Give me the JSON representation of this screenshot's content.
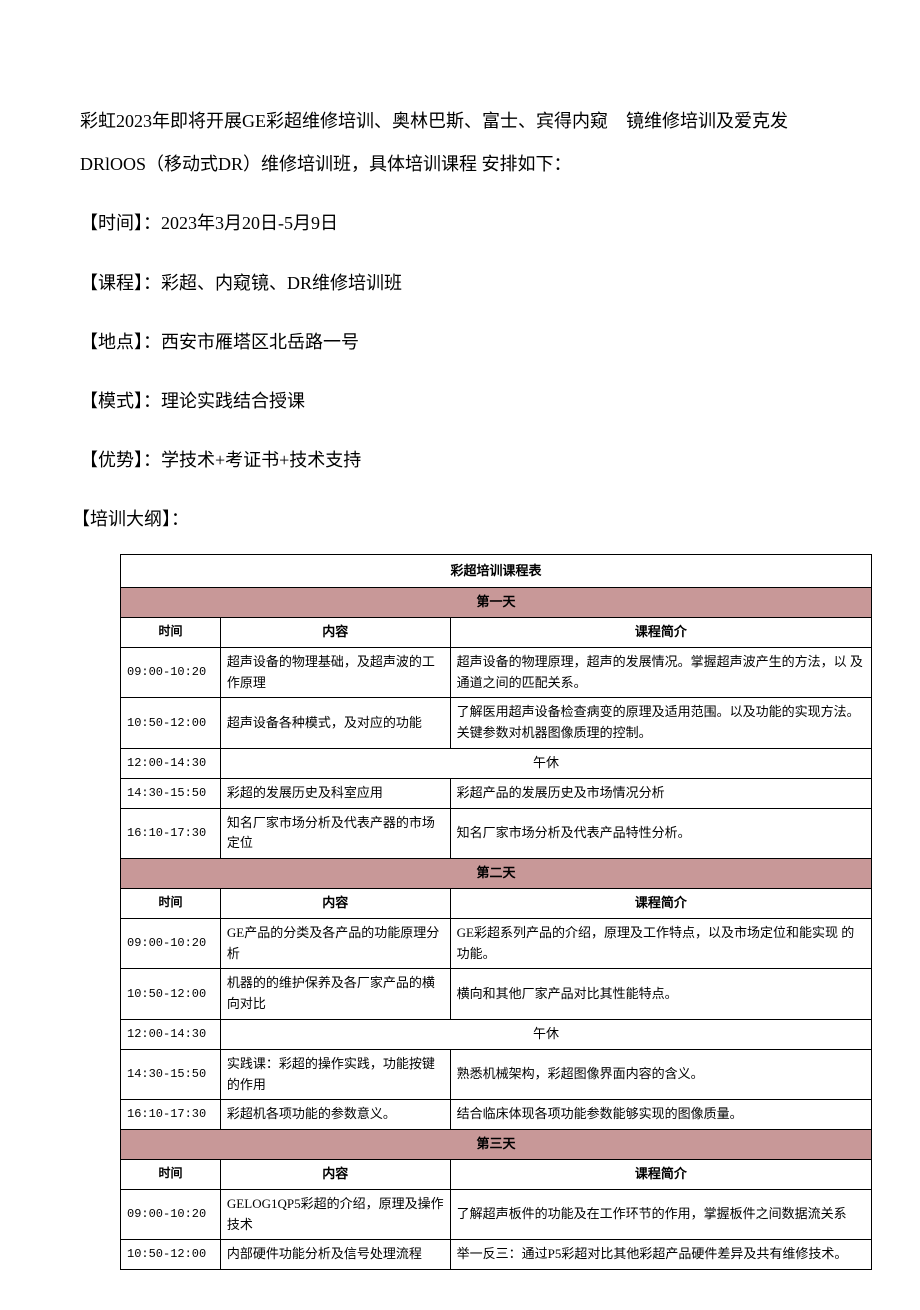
{
  "intro": "彩虹2023年即将开展GE彩超维修培训、奥林巴斯、富士、宾得内窥　镜维修培训及爱克发DRlOOS（移动式DR）维修培训班，具体培训课程 安排如下：",
  "details": {
    "time_label": "【时间】：",
    "time_value": "2023年3月20日-5月9日",
    "course_label": "【课程】：",
    "course_value": "彩超、内窥镜、DR维修培训班",
    "location_label": "【地点】：",
    "location_value": "西安市雁塔区北岳路一号",
    "mode_label": "【模式】：",
    "mode_value": "理论实践结合授课",
    "advantage_label": "【优势】：",
    "advantage_value": "学技术+考证书+技术支持",
    "outline_label": "【培训大纲】："
  },
  "table": {
    "title": "彩超培训课程表",
    "col_headers": {
      "time": "时间",
      "content": "内容",
      "desc": "课程简介"
    },
    "lunch": "午休",
    "days": [
      {
        "header": "第一天",
        "rows": [
          {
            "time": "09:00-10:20",
            "content": "超声设备的物理基础，及超声波的工作原理",
            "desc": "超声设备的物理原理，超声的发展情况。掌握超声波产生的方法，以 及通道之间的匹配关系。"
          },
          {
            "time": "10:50-12:00",
            "content": "超声设备各种模式，及对应的功能",
            "desc": "了解医用超声设备检查病变的原理及适用范围。以及功能的实现方法。关键参数对机器图像质理的控制。"
          },
          {
            "time": "12:00-14:30",
            "lunch": true
          },
          {
            "time": "14:30-15:50",
            "content": "彩超的发展历史及科室应用",
            "desc": "彩超产品的发展历史及市场情况分析"
          },
          {
            "time": "16:10-17:30",
            "content": "知名厂家市场分析及代表产器的市场定位",
            "desc": "知名厂家市场分析及代表产品特性分析。"
          }
        ]
      },
      {
        "header": "第二天",
        "rows": [
          {
            "time": "09:00-10:20",
            "content": "GE产品的分类及各产品的功能原理分析",
            "desc": "GE彩超系列产品的介绍，原理及工作特点，以及市场定位和能实现 的功能。"
          },
          {
            "time": "10:50-12:00",
            "content": "机器的的维护保养及各厂家产品的横向对比",
            "desc": "横向和其他厂家产品对比其性能特点。"
          },
          {
            "time": "12:00-14:30",
            "lunch": true
          },
          {
            "time": "14:30-15:50",
            "content": "实践课：彩超的操作实践，功能按键的作用",
            "desc": "熟悉机械架构，彩超图像界面内容的含义。"
          },
          {
            "time": "16:10-17:30",
            "content": "彩超机各项功能的参数意义。",
            "desc": "结合临床体现各项功能参数能够实现的图像质量。"
          }
        ]
      },
      {
        "header": "第三天",
        "rows": [
          {
            "time": "09:00-10:20",
            "content": "GELOG1QP5彩超的介绍，原理及操作技术",
            "desc": "了解超声板件的功能及在工作环节的作用，掌握板件之间数据流关系"
          },
          {
            "time": "10:50-12:00",
            "content": "内部硬件功能分析及信号处理流程",
            "desc": "举一反三：通过P5彩超对比其他彩超产品硬件差异及共有维修技术。"
          }
        ]
      }
    ]
  }
}
